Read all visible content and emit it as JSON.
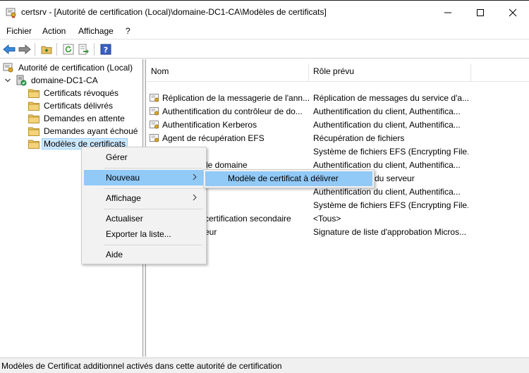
{
  "window": {
    "title": "certsrv - [Autorité de certification (Local)\\domaine-DC1-CA\\Modèles de certificats]",
    "icon": "certsrv-app-icon"
  },
  "menubar": {
    "items": [
      "Fichier",
      "Action",
      "Affichage",
      "?"
    ]
  },
  "toolbar": {
    "icons": [
      "back-arrow-icon",
      "forward-arrow-icon",
      "up-folder-icon",
      "refresh-icon",
      "export-list-icon",
      "help-icon"
    ]
  },
  "tree": {
    "root": "Autorité de certification (Local)",
    "ca": "domaine-DC1-CA",
    "folders": [
      "Certificats révoqués",
      "Certificats délivrés",
      "Demandes en attente",
      "Demandes ayant échoué",
      "Modèles de certificats"
    ]
  },
  "list": {
    "columns": {
      "name": "Nom",
      "role": "Rôle prévu"
    },
    "rows": [
      {
        "name": "Réplication de la messagerie de l'ann...",
        "role": "Réplication de messages du service d'a..."
      },
      {
        "name": "Authentification du contrôleur de do...",
        "role": "Authentification du client, Authentifica..."
      },
      {
        "name": "Authentification Kerberos",
        "role": "Authentification du client, Authentifica..."
      },
      {
        "name": "Agent de récupération EFS",
        "role": "Récupération de fichiers"
      },
      {
        "name": "",
        "role": "Système de fichiers EFS (Encrypting File..."
      },
      {
        "name": "de domaine",
        "role": "Authentification du client, Authentifica..."
      },
      {
        "name": "",
        "role": "du serveur"
      },
      {
        "name": "",
        "role": "Authentification du client, Authentifica..."
      },
      {
        "name": "",
        "role": "Système de fichiers EFS (Encrypting File..."
      },
      {
        "name": "certification secondaire",
        "role": "<Tous>"
      },
      {
        "name": "eur",
        "role": "Signature de liste d'approbation Micros..."
      }
    ]
  },
  "context_menu": {
    "items": [
      "Gérer",
      "Nouveau",
      "Affichage",
      "Actualiser",
      "Exporter la liste...",
      "Aide"
    ],
    "highlighted": "Nouveau"
  },
  "submenu": {
    "item": "Modèle de certificat à délivrer"
  },
  "statusbar": {
    "text": "Modèles de Certificat additionnel activés dans cette autorité de certification"
  },
  "colors": {
    "selection": "#cce8ff",
    "menu_highlight": "#91c9f7",
    "folder": "#e8c25f"
  }
}
